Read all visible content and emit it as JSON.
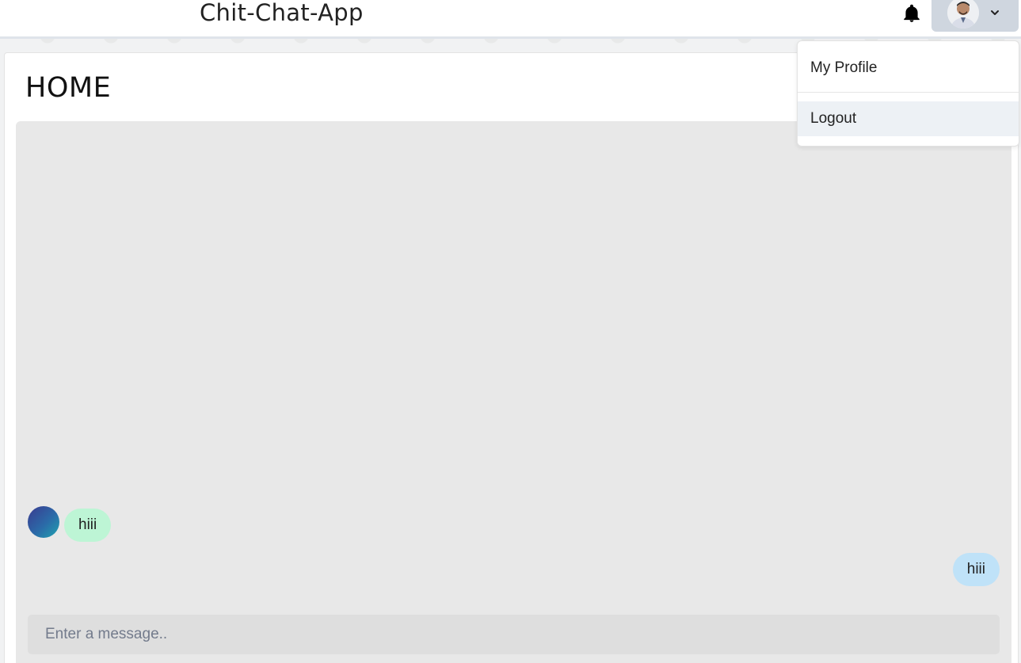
{
  "header": {
    "app_title": "Chit-Chat-App",
    "bell_icon": "bell-icon",
    "avatar_icon": "user-avatar",
    "chevron_icon": "chevron-down-icon"
  },
  "dropdown": {
    "items": [
      {
        "label": "My Profile"
      },
      {
        "label": "Logout"
      }
    ]
  },
  "main": {
    "page_title": "HOME",
    "messages": [
      {
        "side": "received",
        "text": "hiii"
      },
      {
        "side": "sent",
        "text": "hiii"
      }
    ],
    "input": {
      "value": "",
      "placeholder": "Enter a message.."
    }
  },
  "colors": {
    "received_bubble": "#bdf5d5",
    "sent_bubble": "#bfe2f8",
    "chat_background": "#e8e8e8",
    "header_button": "#cfd6df"
  }
}
